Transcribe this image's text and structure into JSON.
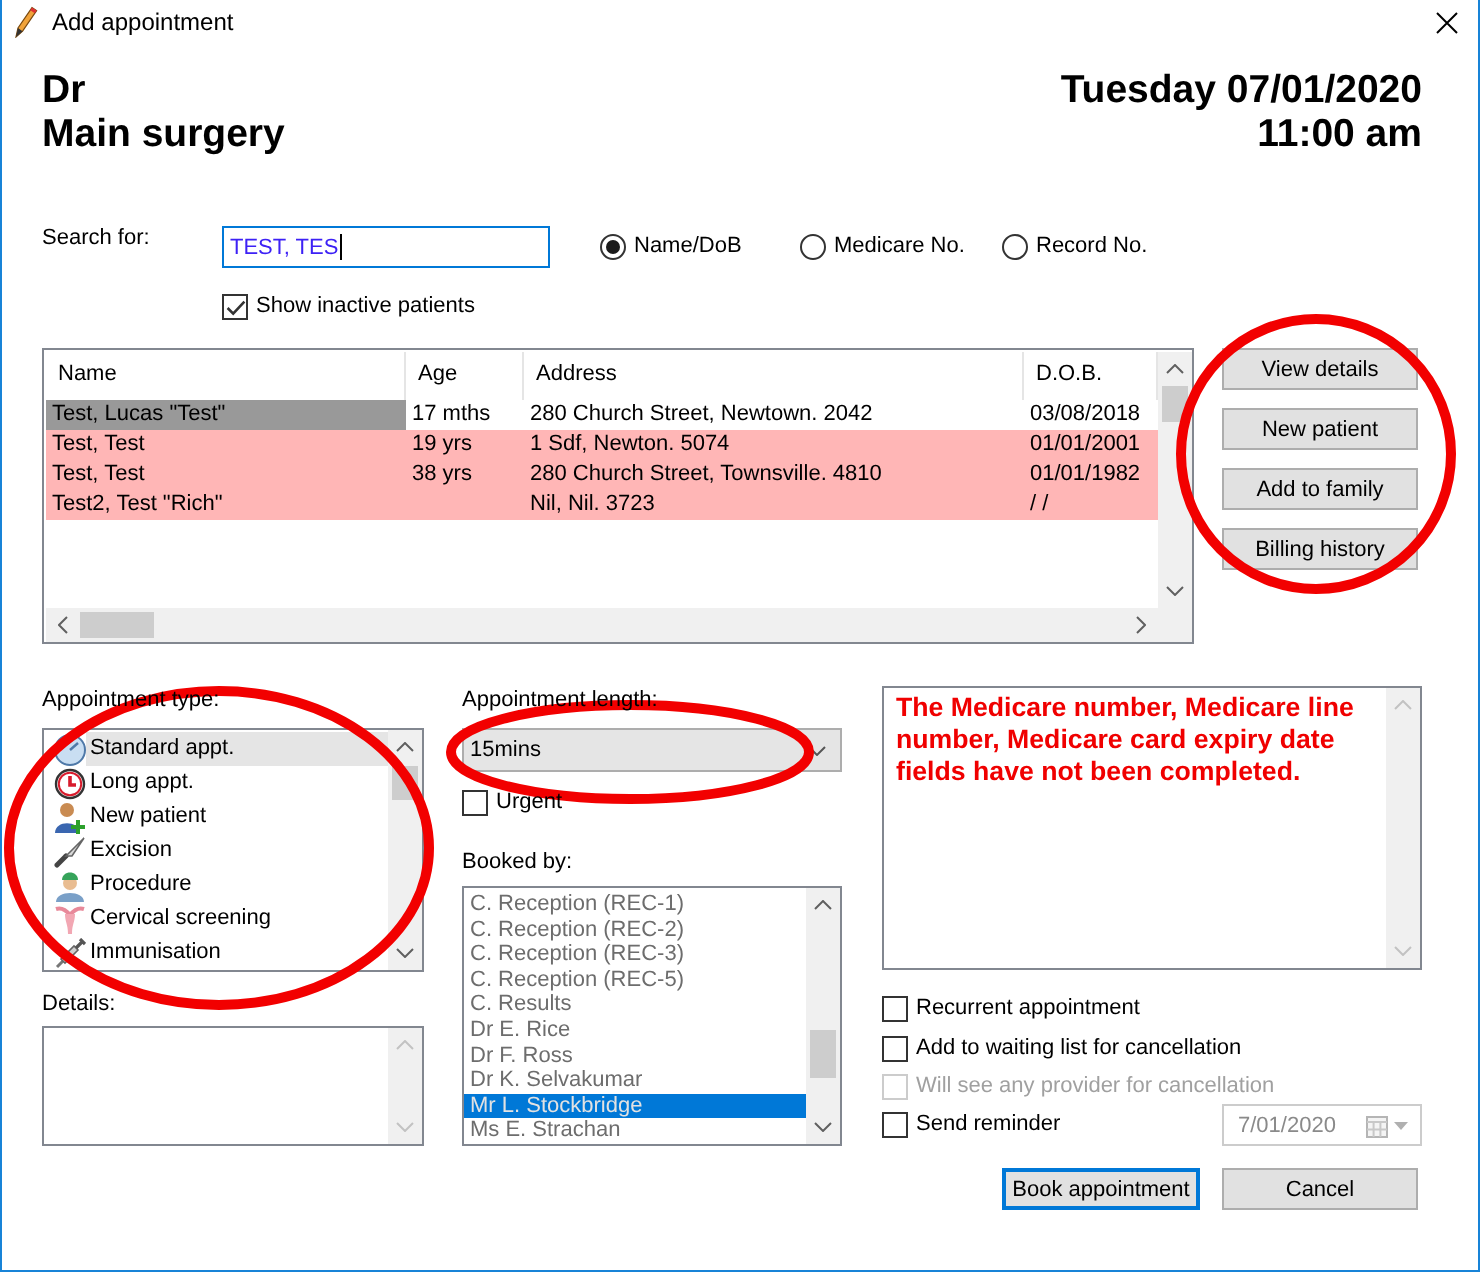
{
  "window": {
    "title": "Add appointment"
  },
  "header": {
    "provider": "Dr",
    "location": "Main surgery",
    "date": "Tuesday 07/01/2020",
    "time": "11:00 am"
  },
  "search": {
    "label": "Search for:",
    "value": "TEST, TES",
    "modes": [
      {
        "label": "Name/DoB",
        "selected": true
      },
      {
        "label": "Medicare No.",
        "selected": false
      },
      {
        "label": "Record No.",
        "selected": false
      }
    ],
    "show_inactive": {
      "label": "Show inactive patients",
      "checked": true
    }
  },
  "patients": {
    "columns": [
      "Name",
      "Age",
      "Address",
      "D.O.B."
    ],
    "rows": [
      {
        "name": "Test, Lucas \"Test\"",
        "age": "17 mths",
        "address": "280 Church Street, Newtown. 2042",
        "dob": "03/08/2018",
        "selected": true,
        "flagged": false
      },
      {
        "name": "Test, Test",
        "age": "19 yrs",
        "address": "1 Sdf, Newton. 5074",
        "dob": "01/01/2001",
        "selected": false,
        "flagged": true
      },
      {
        "name": "Test, Test",
        "age": "38 yrs",
        "address": "280 Church Street, Townsville. 4810",
        "dob": "01/01/1982",
        "selected": false,
        "flagged": true
      },
      {
        "name": "Test2, Test \"Rich\"",
        "address": "Nil, Nil. 3723",
        "dob": "/ /",
        "selected": false,
        "flagged": true
      }
    ]
  },
  "patient_actions": {
    "highlighted": true,
    "buttons": [
      "View details",
      "New patient",
      "Add to family",
      "Billing history"
    ]
  },
  "appointment_type": {
    "label": "Appointment type:",
    "highlighted": true,
    "items": [
      {
        "label": "Standard appt.",
        "kind": "standard",
        "selected": true
      },
      {
        "label": "Long appt.",
        "kind": "long",
        "selected": false
      },
      {
        "label": "New patient",
        "kind": "new_patient",
        "selected": false
      },
      {
        "label": "Excision",
        "kind": "excision",
        "selected": false
      },
      {
        "label": "Procedure",
        "kind": "procedure",
        "selected": false
      },
      {
        "label": "Cervical screening",
        "kind": "screening",
        "selected": false
      },
      {
        "label": "Immunisation",
        "kind": "immunisation",
        "selected": false
      }
    ]
  },
  "details": {
    "label": "Details:"
  },
  "appointment_length": {
    "label": "Appointment length:",
    "value": "15mins",
    "highlighted": true
  },
  "urgent": {
    "label": "Urgent",
    "checked": false
  },
  "booked_by": {
    "label": "Booked by:",
    "disabled": true,
    "items": [
      {
        "label": "C. Reception (REC-1)",
        "selected": false
      },
      {
        "label": "C. Reception (REC-2)",
        "selected": false
      },
      {
        "label": "C. Reception (REC-3)",
        "selected": false
      },
      {
        "label": "C. Reception (REC-5)",
        "selected": false
      },
      {
        "label": "C. Results",
        "selected": false
      },
      {
        "label": "Dr E. Rice",
        "selected": false
      },
      {
        "label": "Dr F. Ross",
        "selected": false
      },
      {
        "label": "Dr K. Selvakumar",
        "selected": false
      },
      {
        "label": "Mr L. Stockbridge",
        "selected": true
      },
      {
        "label": "Ms E. Strachan",
        "selected": false
      }
    ]
  },
  "message": "The Medicare number, Medicare line number, Medicare card expiry date fields have not been completed.",
  "options": [
    {
      "label": "Recurrent appointment",
      "checked": false,
      "disabled": false
    },
    {
      "label": "Add to waiting list for cancellation",
      "checked": false,
      "disabled": false
    },
    {
      "label": "Will see any provider for cancellation",
      "checked": false,
      "disabled": true
    }
  ],
  "reminder": {
    "label": "Send reminder",
    "checked": false,
    "date": "7/01/2020",
    "date_disabled": true
  },
  "buttons": [
    {
      "label": "Book appointment",
      "default": true
    },
    {
      "label": "Cancel",
      "default": false
    }
  ]
}
